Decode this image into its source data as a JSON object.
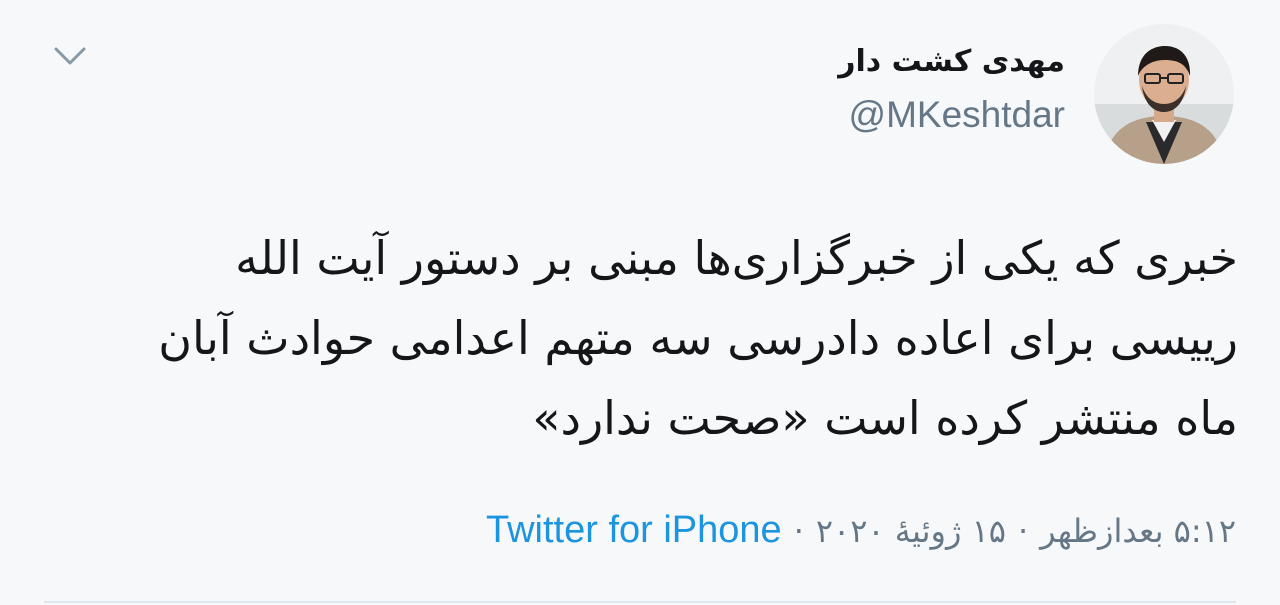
{
  "tweet": {
    "author": {
      "display_name": "مهدی کشت دار",
      "handle": "@MKeshtdar"
    },
    "text": "خبری که یکی از خبرگزاری‌ها مبنی بر دستور آیت الله رییسی برای اعاده دادرسی سه متهم اعدامی حوادث آبان ماه منتشر کرده است «صحت ندارد»",
    "time": "۵:۱۲ بعدازظهر",
    "date": "۱۵ ژوئیهٔ ۲۰۲۰",
    "separator": "·",
    "source": "Twitter for iPhone"
  },
  "icons": {
    "menu": "chevron-down-icon",
    "avatar": "profile-photo"
  },
  "colors": {
    "background": "#f7f8f9",
    "text": "#14171a",
    "secondary": "#657786",
    "link": "#1b95e0",
    "divider": "#e1e8ed"
  }
}
